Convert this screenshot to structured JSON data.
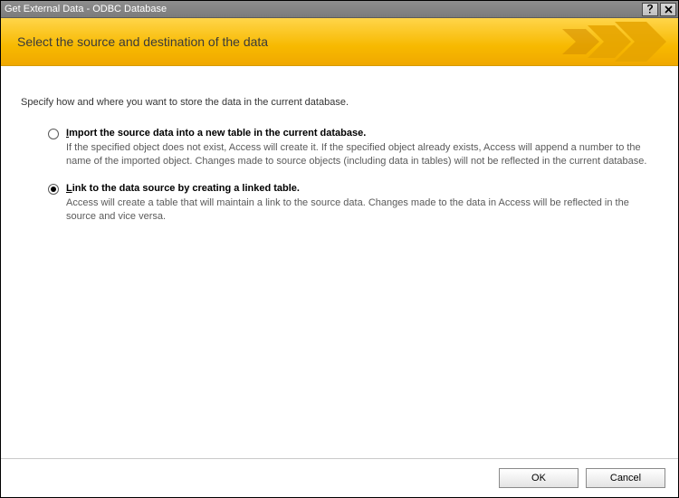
{
  "window": {
    "title": "Get External Data - ODBC Database"
  },
  "banner": {
    "heading": "Select the source and destination of the data"
  },
  "instruction": "Specify how and where you want to store the data in the current database.",
  "options": {
    "import": {
      "mnemonic": "I",
      "label_rest": "mport the source data into a new table in the current database.",
      "description": "If the specified object does not exist, Access will create it. If the specified object already exists, Access will append a number to the name of the imported object. Changes made to source objects (including data in tables) will not be reflected in the current database.",
      "selected": false
    },
    "link": {
      "mnemonic": "L",
      "label_rest": "ink to the data source by creating a linked table.",
      "description": "Access will create a table that will maintain a link to the source data. Changes made to the data in Access will be reflected in the source and vice versa.",
      "selected": true
    }
  },
  "buttons": {
    "ok": "OK",
    "cancel": "Cancel"
  }
}
